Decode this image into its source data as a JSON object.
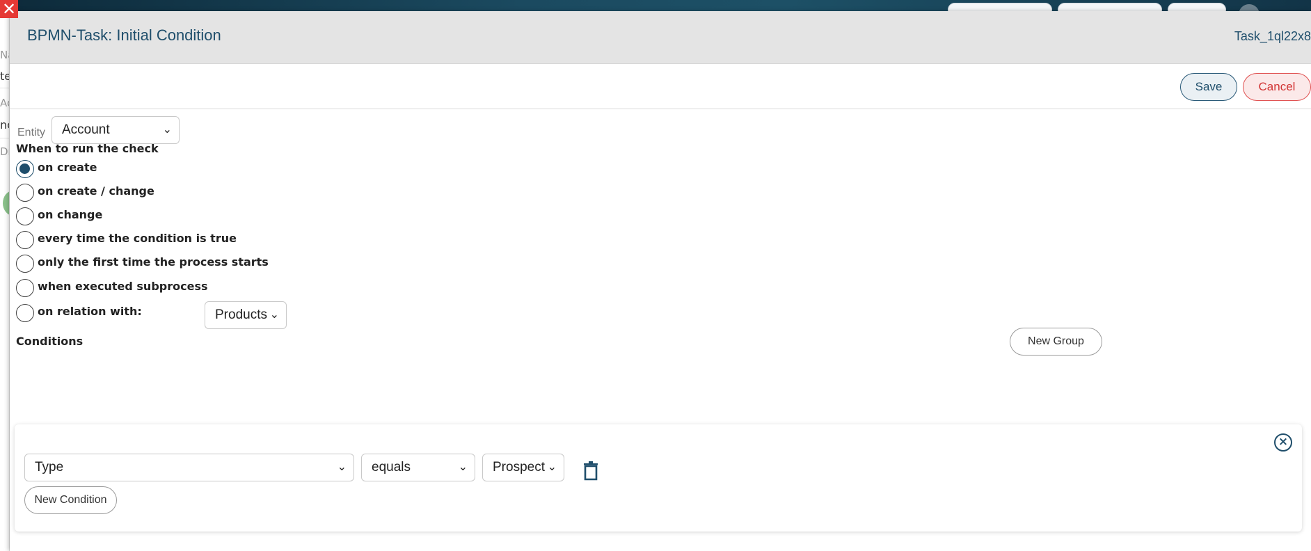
{
  "background": {
    "left_snippets": [
      "Na",
      "te",
      "Ac",
      "nc",
      "Dr"
    ]
  },
  "modal": {
    "title": "BPMN-Task: Initial Condition",
    "task_id": "Task_1ql22x8",
    "close_icon": "close-icon"
  },
  "toolbar": {
    "save_label": "Save",
    "cancel_label": "Cancel"
  },
  "entity": {
    "label": "Entity",
    "value": "Account"
  },
  "run_check": {
    "heading": "When to run the check",
    "options": [
      {
        "label": "on create",
        "checked": true
      },
      {
        "label": "on create / change",
        "checked": false
      },
      {
        "label": "on change",
        "checked": false
      },
      {
        "label": "every time the condition is true",
        "checked": false
      },
      {
        "label": "only the first time the process starts",
        "checked": false
      },
      {
        "label": "when executed subprocess",
        "checked": false
      },
      {
        "label": "on relation with:",
        "checked": false
      }
    ],
    "relation_value": "Products"
  },
  "conditions": {
    "heading": "Conditions",
    "new_group_label": "New Group",
    "field_value": "Type",
    "operator_value": "equals",
    "compare_value": "Prospect",
    "new_condition_label": "New Condition"
  },
  "colors": {
    "accent": "#1f4e6b",
    "danger": "#d23434",
    "header_bg": "#e4e4e4"
  }
}
